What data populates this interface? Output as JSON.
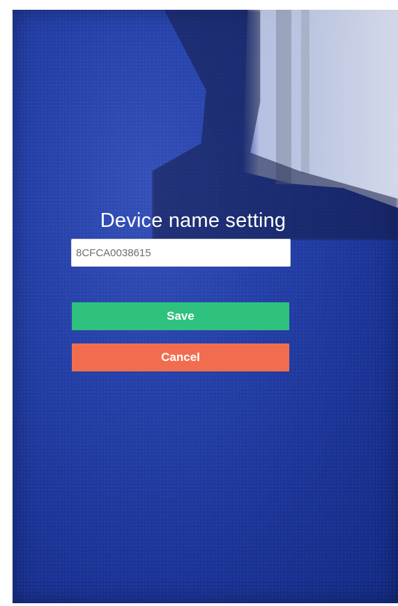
{
  "dialog": {
    "title": "Device name setting",
    "device_name_value": "8CFCA0038615",
    "save_label": "Save",
    "cancel_label": "Cancel"
  },
  "colors": {
    "screen_background": "#1f3aa0",
    "save_button": "#2ec27e",
    "cancel_button": "#f26d4f",
    "text": "#ffffff"
  }
}
